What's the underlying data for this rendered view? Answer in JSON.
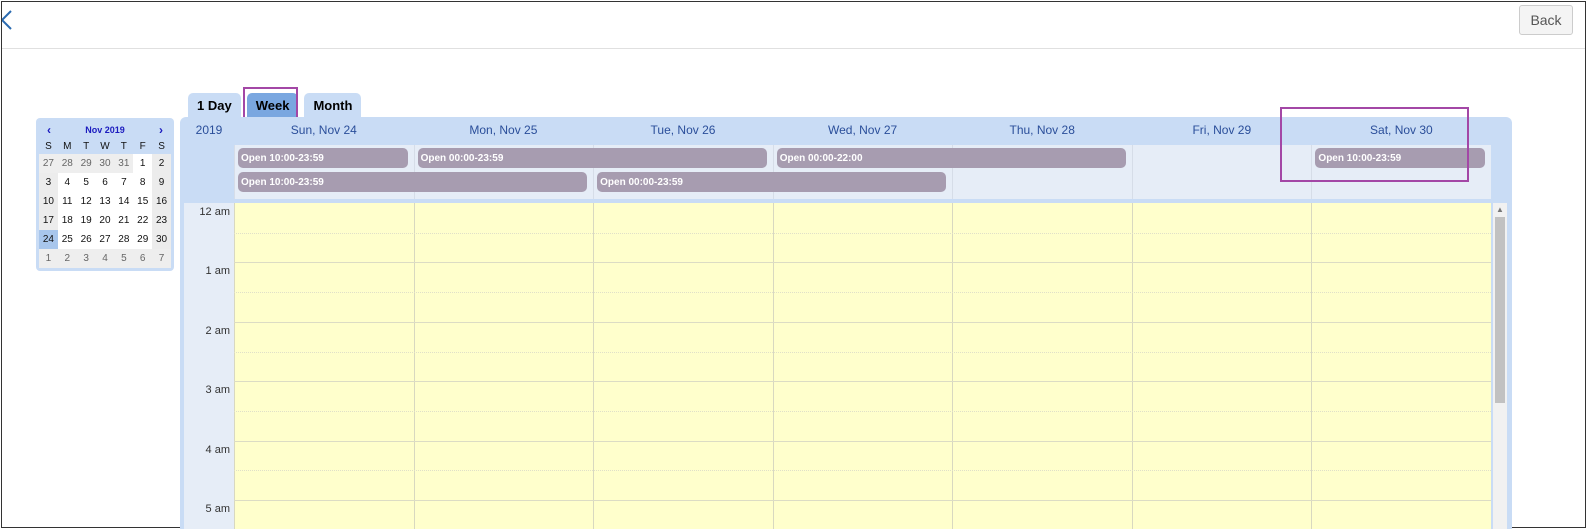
{
  "topbar": {
    "back_label": "Back"
  },
  "tabs": [
    {
      "label": "1 Day",
      "active": false
    },
    {
      "label": "Week",
      "active": true
    },
    {
      "label": "Month",
      "active": false
    }
  ],
  "mini_calendar": {
    "month_label": "Nov 2019",
    "prev": "‹",
    "next": "›",
    "dows": [
      "S",
      "M",
      "T",
      "W",
      "T",
      "F",
      "S"
    ],
    "weeks": [
      [
        "27",
        "28",
        "29",
        "30",
        "31",
        "1",
        "2"
      ],
      [
        "3",
        "4",
        "5",
        "6",
        "7",
        "8",
        "9"
      ],
      [
        "10",
        "11",
        "12",
        "13",
        "14",
        "15",
        "16"
      ],
      [
        "17",
        "18",
        "19",
        "20",
        "21",
        "22",
        "23"
      ],
      [
        "24",
        "25",
        "26",
        "27",
        "28",
        "29",
        "30"
      ],
      [
        "1",
        "2",
        "3",
        "4",
        "5",
        "6",
        "7"
      ]
    ],
    "selected": "24"
  },
  "week": {
    "year": "2019",
    "days": [
      "Sun, Nov 24",
      "Mon, Nov 25",
      "Tue, Nov 26",
      "Wed, Nov 27",
      "Thu, Nov 28",
      "Fri, Nov 29",
      "Sat, Nov 30"
    ],
    "events": [
      {
        "label": "Open 10:00-23:59",
        "start": 0,
        "span": 1,
        "row": 0
      },
      {
        "label": "Open 00:00-23:59",
        "start": 1,
        "span": 2,
        "row": 0
      },
      {
        "label": "Open 00:00-22:00",
        "start": 3,
        "span": 2,
        "row": 0
      },
      {
        "label": "Open 10:00-23:59",
        "start": 6,
        "span": 1,
        "row": 0
      },
      {
        "label": "Open 10:00-23:59",
        "start": 0,
        "span": 2,
        "row": 1
      },
      {
        "label": "Open 00:00-23:59",
        "start": 2,
        "span": 2,
        "row": 1
      }
    ],
    "hours": [
      "12 am",
      "1 am",
      "2 am",
      "3 am",
      "4 am",
      "5 am"
    ]
  },
  "colors": {
    "calendar_bg": "#c9dcf5",
    "event_bg": "#a79cb0",
    "time_bg": "#ffffcc",
    "highlight": "#a347a6"
  }
}
